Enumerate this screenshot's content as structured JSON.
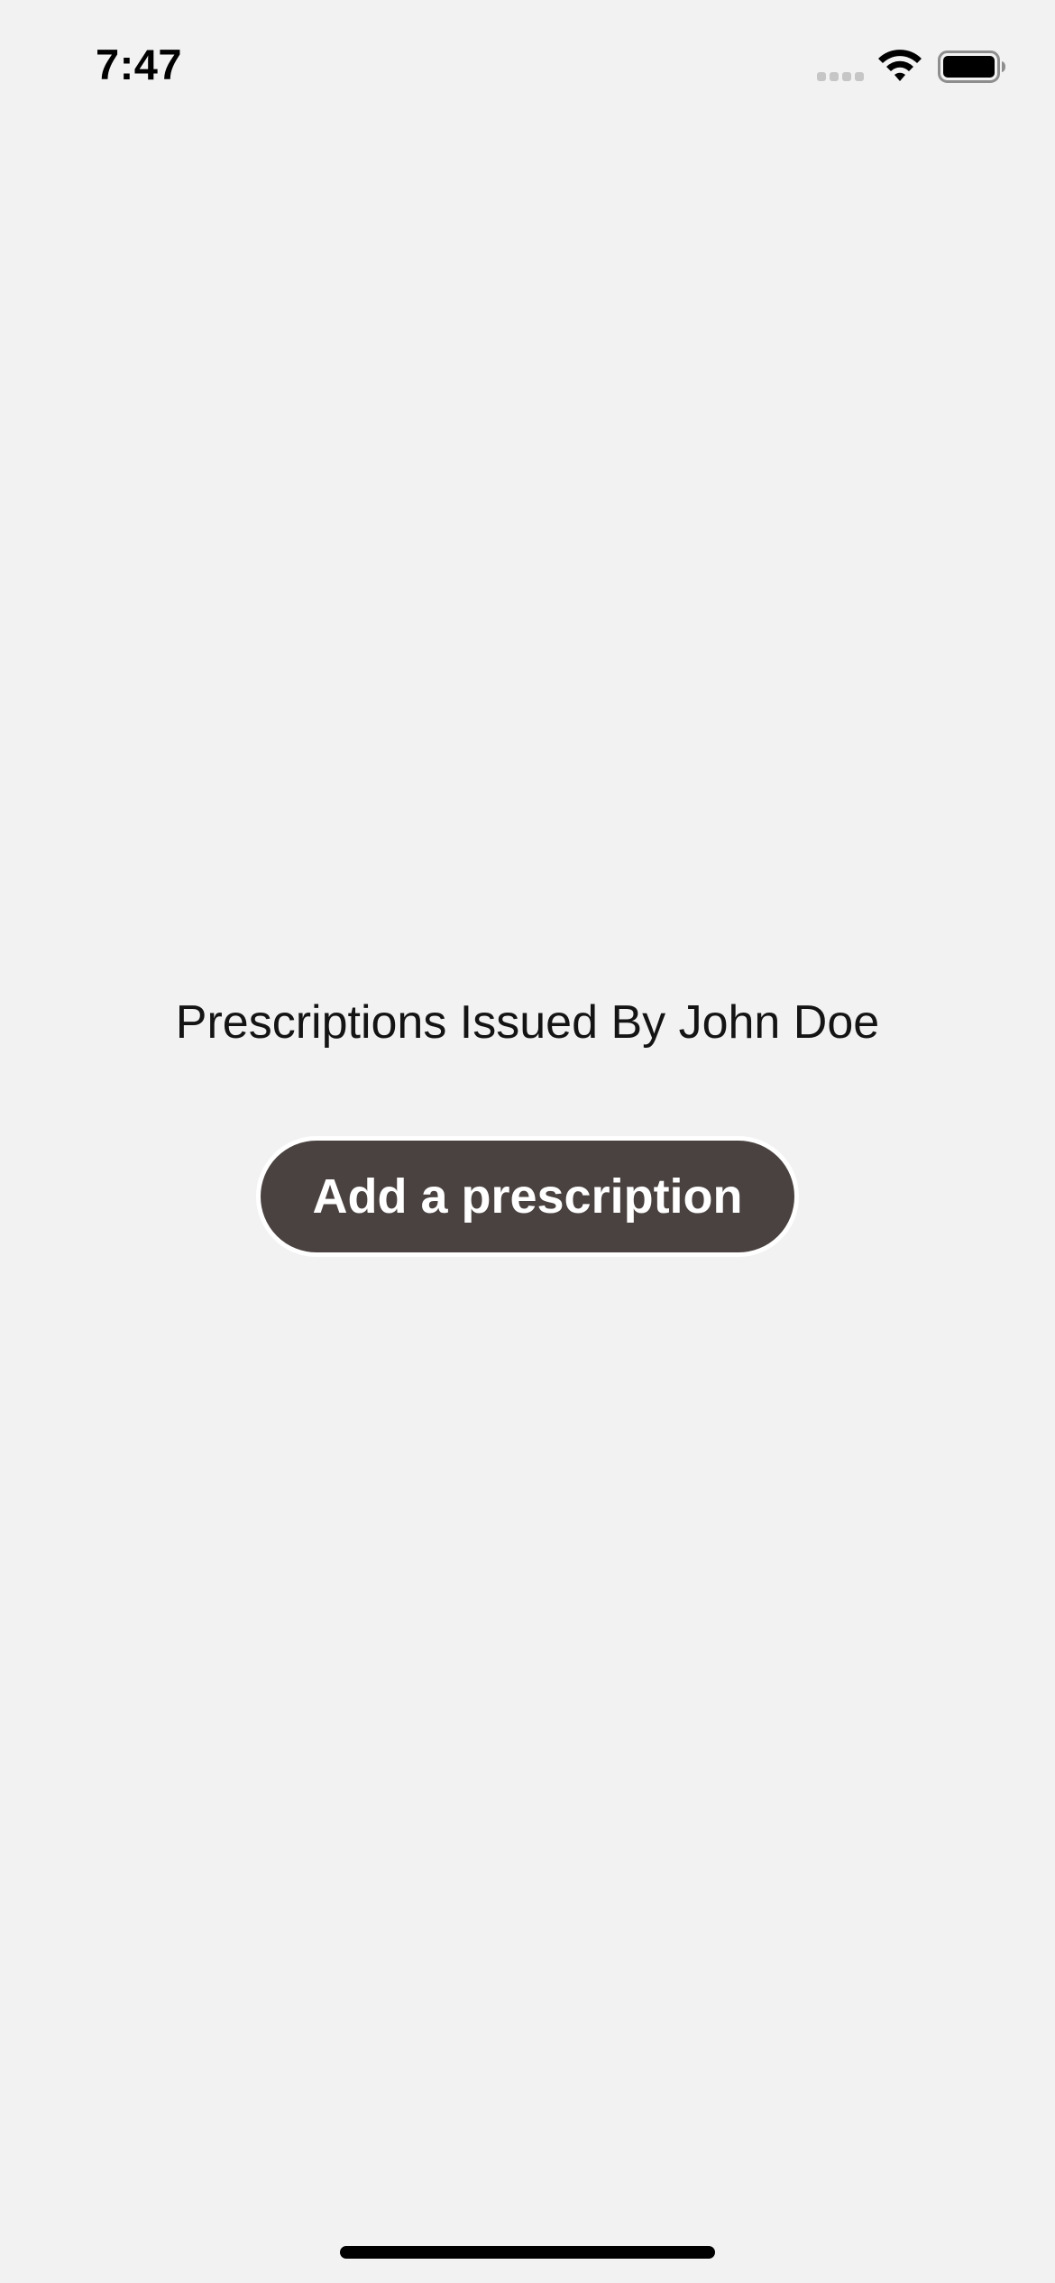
{
  "status_bar": {
    "time": "7:47",
    "signal_icon": "cellular-signal-icon",
    "wifi_icon": "wifi-icon",
    "battery_icon": "battery-icon"
  },
  "main": {
    "title": "Prescriptions Issued By John Doe",
    "add_button_label": "Add a prescription"
  },
  "colors": {
    "background": "#f2f2f2",
    "button_fill": "#4a4240",
    "button_text": "#ffffff",
    "title_text": "#141414"
  }
}
